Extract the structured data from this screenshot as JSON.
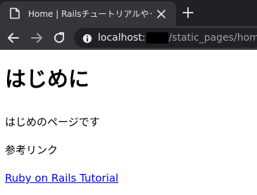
{
  "browser": {
    "tab": {
      "title": "Home | Railsチュートリアルやったよ!!",
      "favicon": "document-icon",
      "close_icon": "close-icon"
    },
    "new_tab_icon": "plus-icon",
    "toolbar": {
      "back_icon": "arrow-left-icon",
      "forward_icon": "arrow-right-icon",
      "reload_icon": "reload-icon",
      "site_info_icon": "info-icon",
      "url_host": "localhost:",
      "url_path": "/static_pages/home"
    },
    "colors": {
      "tabstrip": "#202124",
      "active_tab": "#35363a",
      "omnibox": "#202124",
      "text_light": "#e8eaed",
      "text_dim": "#9aa0a6",
      "link": "#0000ee"
    }
  },
  "page": {
    "title": "はじめに",
    "intro": "はじめのページです",
    "ref_label": "参考リンク",
    "link_text": "Ruby on Rails Tutorial"
  }
}
